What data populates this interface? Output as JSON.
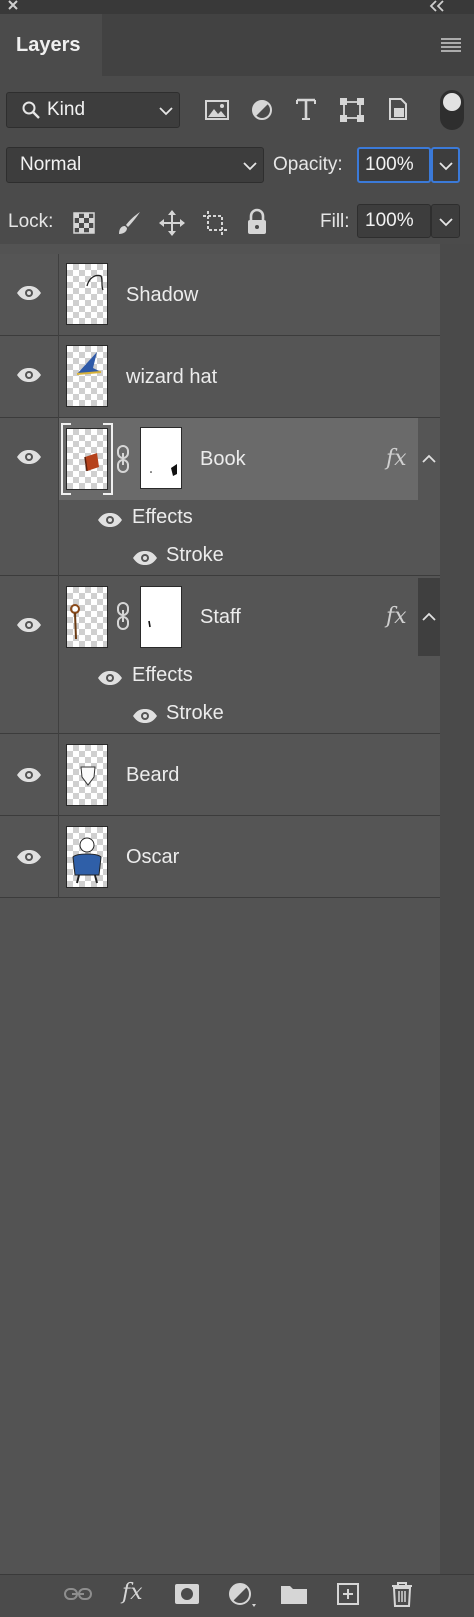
{
  "panel": {
    "title": "Layers"
  },
  "filter": {
    "kind_label": "Kind"
  },
  "blend": {
    "mode": "Normal",
    "opacity_label": "Opacity:",
    "opacity_value": "100%"
  },
  "lock": {
    "label": "Lock:",
    "fill_label": "Fill:",
    "fill_value": "100%"
  },
  "layers": [
    {
      "name": "Shadow"
    },
    {
      "name": "wizard hat"
    },
    {
      "name": "Book",
      "fx": "fx",
      "effects_label": "Effects",
      "effect": "Stroke"
    },
    {
      "name": "Staff",
      "fx": "fx",
      "effects_label": "Effects",
      "effect": "Stroke"
    },
    {
      "name": "Beard"
    },
    {
      "name": "Oscar"
    }
  ],
  "bottom": {
    "fx_label": "fx"
  },
  "colors": {
    "panel_bg": "#535353",
    "selected_row": "#6a6a6a",
    "focus_border": "#3b7ad9"
  }
}
